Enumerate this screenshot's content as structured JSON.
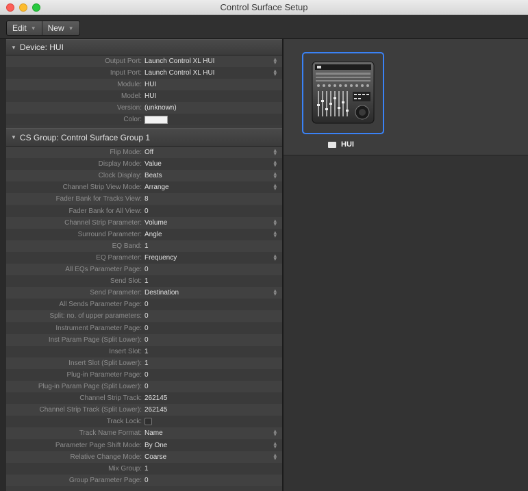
{
  "window": {
    "title": "Control Surface Setup"
  },
  "toolbar": {
    "edit_label": "Edit",
    "new_label": "New"
  },
  "device": {
    "header": "Device: HUI",
    "rows": [
      {
        "label": "Output Port:",
        "value": "Launch Control XL HUI",
        "stepper": true
      },
      {
        "label": "Input Port:",
        "value": "Launch Control XL HUI",
        "stepper": true
      },
      {
        "label": "Module:",
        "value": "HUI",
        "stepper": false
      },
      {
        "label": "Model:",
        "value": "HUI",
        "stepper": false
      },
      {
        "label": "Version:",
        "value": "(unknown)",
        "stepper": false
      },
      {
        "label": "Color:",
        "value": "",
        "stepper": false,
        "kind": "swatch"
      }
    ]
  },
  "group": {
    "header": "CS Group:  Control Surface Group 1",
    "rows": [
      {
        "label": "Flip Mode:",
        "value": "Off",
        "stepper": true
      },
      {
        "label": "Display Mode:",
        "value": "Value",
        "stepper": true
      },
      {
        "label": "Clock Display:",
        "value": "Beats",
        "stepper": true
      },
      {
        "label": "Channel Strip View Mode:",
        "value": "Arrange",
        "stepper": true
      },
      {
        "label": "Fader Bank for Tracks View:",
        "value": "8",
        "stepper": false
      },
      {
        "label": "Fader Bank for All View:",
        "value": "0",
        "stepper": false
      },
      {
        "label": "Channel Strip Parameter:",
        "value": "Volume",
        "stepper": true
      },
      {
        "label": "Surround Parameter:",
        "value": "Angle",
        "stepper": true
      },
      {
        "label": "EQ Band:",
        "value": "1",
        "stepper": false
      },
      {
        "label": "EQ Parameter:",
        "value": "Frequency",
        "stepper": true
      },
      {
        "label": "All EQs Parameter Page:",
        "value": "0",
        "stepper": false
      },
      {
        "label": "Send Slot:",
        "value": "1",
        "stepper": false
      },
      {
        "label": "Send Parameter:",
        "value": "Destination",
        "stepper": true
      },
      {
        "label": "All Sends Parameter Page:",
        "value": "0",
        "stepper": false
      },
      {
        "label": "Split: no. of upper parameters:",
        "value": "0",
        "stepper": false
      },
      {
        "label": "Instrument Parameter Page:",
        "value": "0",
        "stepper": false
      },
      {
        "label": "Inst Param Page (Split Lower):",
        "value": "0",
        "stepper": false
      },
      {
        "label": "Insert Slot:",
        "value": "1",
        "stepper": false
      },
      {
        "label": "Insert Slot (Split Lower):",
        "value": "1",
        "stepper": false
      },
      {
        "label": "Plug-in Parameter Page:",
        "value": "0",
        "stepper": false
      },
      {
        "label": "Plug-in Param Page (Split Lower):",
        "value": "0",
        "stepper": false
      },
      {
        "label": "Channel Strip Track:",
        "value": "262145",
        "stepper": false
      },
      {
        "label": "Channel Strip Track (Split Lower):",
        "value": "262145",
        "stepper": false
      },
      {
        "label": "Track Lock:",
        "value": "",
        "stepper": false,
        "kind": "checkbox"
      },
      {
        "label": "Track Name Format:",
        "value": "Name",
        "stepper": true
      },
      {
        "label": "Parameter Page Shift Mode:",
        "value": "By One",
        "stepper": true
      },
      {
        "label": "Relative Change Mode:",
        "value": "Coarse",
        "stepper": true
      },
      {
        "label": "Mix Group:",
        "value": "1",
        "stepper": false
      },
      {
        "label": "Group Parameter Page:",
        "value": "0",
        "stepper": false
      }
    ]
  },
  "surface": {
    "name": "HUI",
    "icon": "hui-controller-icon"
  },
  "colors": {
    "selection": "#3a82f6",
    "panel": "#3c3c3c",
    "background": "#333333"
  }
}
